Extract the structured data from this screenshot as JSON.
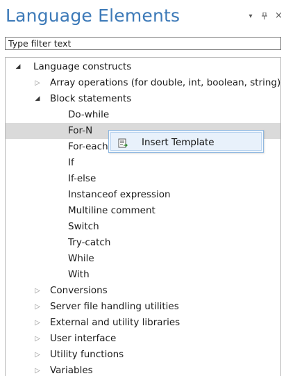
{
  "panel": {
    "title": "Language Elements",
    "actions": [
      {
        "name": "dropdown-icon",
        "glyph": "▾"
      },
      {
        "name": "pin-icon",
        "glyph": "⊼"
      },
      {
        "name": "close-icon",
        "glyph": "×"
      }
    ]
  },
  "filter": {
    "value": "Type filter text"
  },
  "tree": {
    "rows": [
      {
        "label": "Language constructs",
        "level": 0,
        "arrow": "expanded"
      },
      {
        "label": "Array operations (for double, int, boolean, string)",
        "level": 1,
        "arrow": "collapsed"
      },
      {
        "label": "Block statements",
        "level": 1,
        "arrow": "expanded"
      },
      {
        "label": "Do-while",
        "level": 2,
        "arrow": "none"
      },
      {
        "label": "For-N",
        "level": 2,
        "arrow": "none",
        "selected": true
      },
      {
        "label": "For-each",
        "level": 2,
        "arrow": "none"
      },
      {
        "label": "If",
        "level": 2,
        "arrow": "none"
      },
      {
        "label": "If-else",
        "level": 2,
        "arrow": "none"
      },
      {
        "label": "Instanceof expression",
        "level": 2,
        "arrow": "none"
      },
      {
        "label": "Multiline comment",
        "level": 2,
        "arrow": "none"
      },
      {
        "label": "Switch",
        "level": 2,
        "arrow": "none"
      },
      {
        "label": "Try-catch",
        "level": 2,
        "arrow": "none"
      },
      {
        "label": "While",
        "level": 2,
        "arrow": "none"
      },
      {
        "label": "With",
        "level": 2,
        "arrow": "none"
      },
      {
        "label": "Conversions",
        "level": 1,
        "arrow": "collapsed"
      },
      {
        "label": "Server file handling utilities",
        "level": 1,
        "arrow": "collapsed"
      },
      {
        "label": "External and utility libraries",
        "level": 1,
        "arrow": "collapsed"
      },
      {
        "label": "User interface",
        "level": 1,
        "arrow": "collapsed"
      },
      {
        "label": "Utility functions",
        "level": 1,
        "arrow": "collapsed"
      },
      {
        "label": "Variables",
        "level": 1,
        "arrow": "collapsed"
      }
    ]
  },
  "context_menu": {
    "item": {
      "label": "Insert Template",
      "icon": "insert-template-icon"
    }
  }
}
